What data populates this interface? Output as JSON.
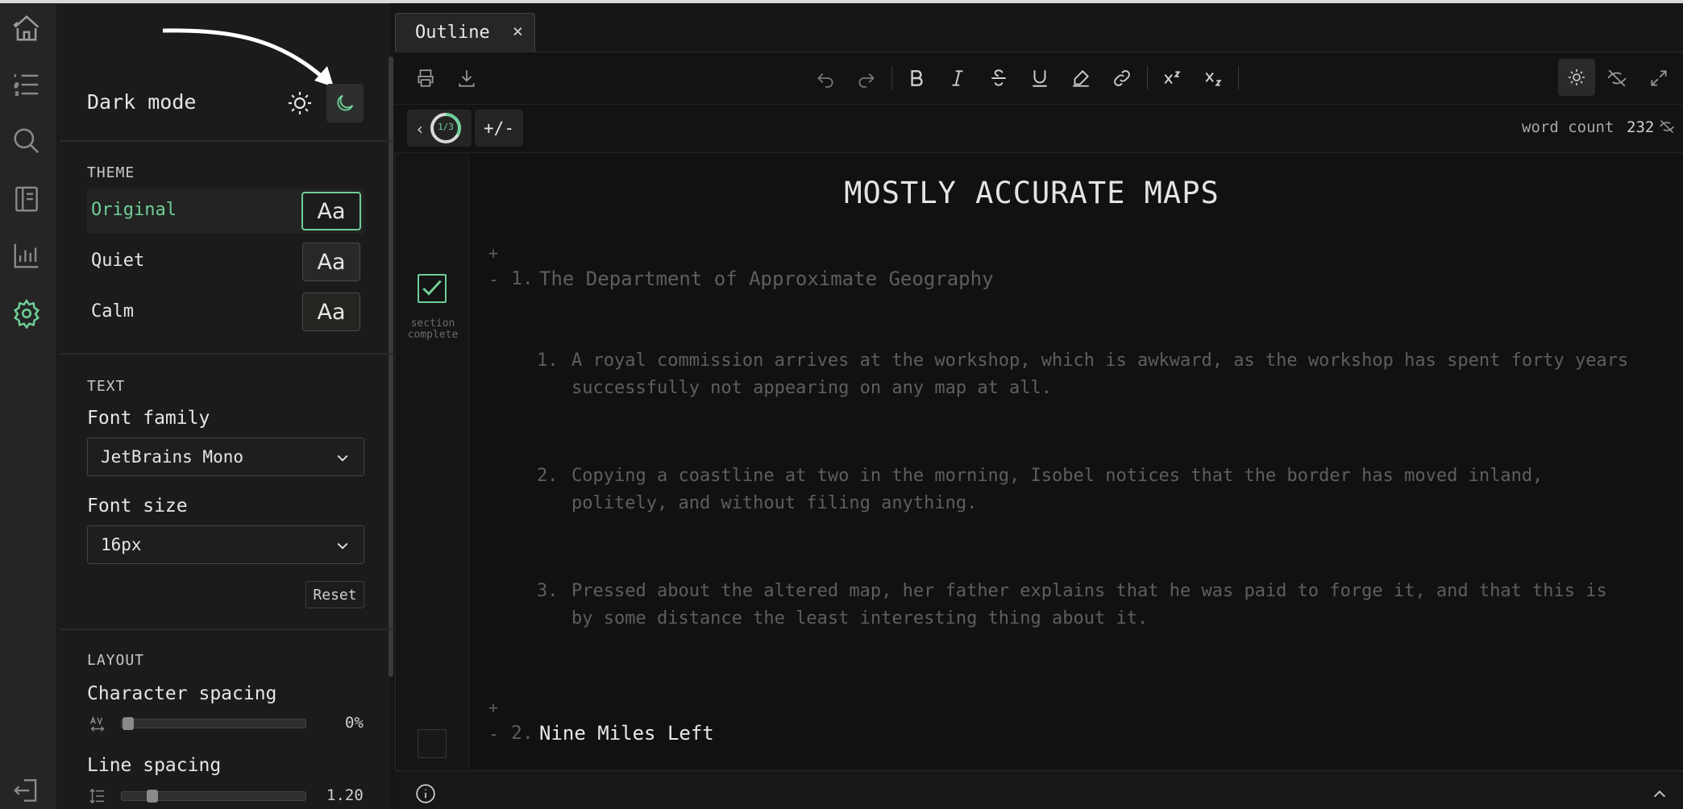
{
  "settings": {
    "dark_mode_label": "Dark mode",
    "theme_section": "THEME",
    "themes": [
      {
        "name": "Original",
        "sample": "Aa"
      },
      {
        "name": "Quiet",
        "sample": "Aa"
      },
      {
        "name": "Calm",
        "sample": "Aa"
      }
    ],
    "text_section": "TEXT",
    "font_family_label": "Font family",
    "font_family_value": "JetBrains Mono",
    "font_size_label": "Font size",
    "font_size_value": "16px",
    "reset_label": "Reset",
    "layout_section": "LAYOUT",
    "char_spacing_label": "Character spacing",
    "char_spacing_value": "0%",
    "char_spacing_level": 0.0,
    "line_spacing_label": "Line spacing",
    "line_spacing_value": "1.20",
    "line_spacing_level": 0.14
  },
  "tab": {
    "label": "Outline",
    "close": "×"
  },
  "subbar": {
    "progress_label": "1/3",
    "progress_fraction": 0.33,
    "expand_label": "+/-",
    "word_count_label": "word count",
    "word_count_value": "232"
  },
  "document": {
    "title": "MOSTLY ACCURATE MAPS",
    "plus": "+",
    "minus": "-",
    "section_1": {
      "number": "1.",
      "heading": "The Department of Approximate Geography",
      "status": "section complete",
      "items": [
        {
          "num": "1.",
          "line1": "A royal commission arrives at the workshop, which is awkward, as the workshop has spent forty years",
          "line2": "successfully not appearing on any map at all."
        },
        {
          "num": "2.",
          "line1": "Copying a coastline at two in the morning, Isobel notices that the border has moved inland,",
          "line2": "politely, and without filing anything."
        },
        {
          "num": "3.",
          "line1": "Pressed about the altered map, her father explains that he was paid to forge it, and that this is",
          "line2": "by some distance the least interesting thing about it."
        }
      ]
    },
    "section_2": {
      "number": "2.",
      "heading": "Nine Miles Left"
    }
  },
  "colors": {
    "accent": "#6fcf97",
    "background": "#111111",
    "panel": "#1b1b1b"
  }
}
